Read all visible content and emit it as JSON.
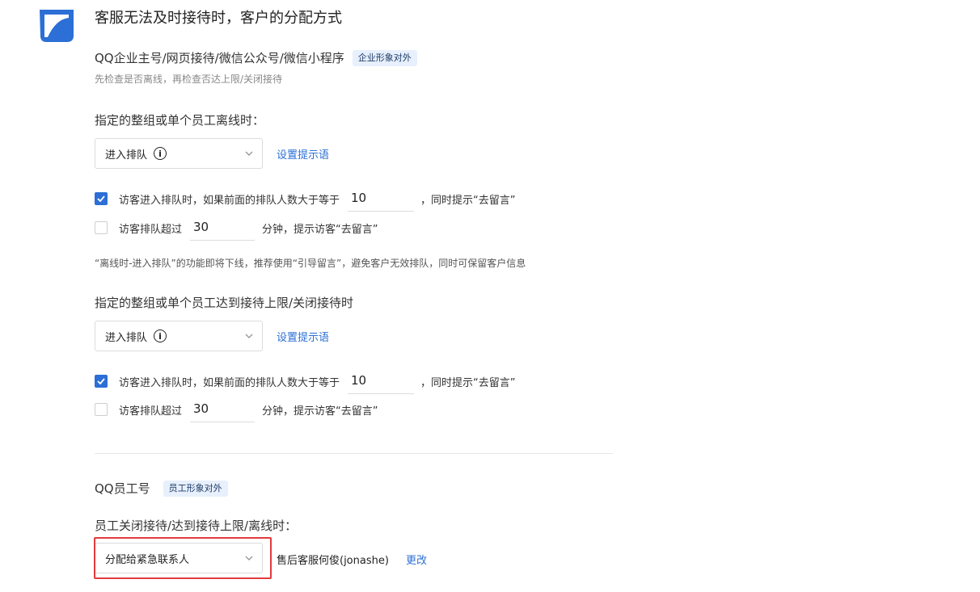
{
  "page": {
    "title": "客服无法及时接待时，客户的分配方式"
  },
  "section_enterprise": {
    "heading": "QQ企业主号/网页接待/微信公众号/微信小程序",
    "tag": "企业形象对外",
    "hint": "先检查是否离线，再检查否达上限/关闭接待",
    "offline": {
      "label": "指定的整组或单个员工离线时：",
      "select_value": "进入排队",
      "link": "设置提示语",
      "opt1": {
        "checked": true,
        "text_before": "访客进入排队时，如果前面的排队人数大于等于",
        "value": "10",
        "text_after": "，同时提示“去留言”"
      },
      "opt2": {
        "checked": false,
        "text_before": "访客排队超过",
        "value": "30",
        "text_after": "分钟，提示访客“去留言”"
      },
      "note": "“离线时-进入排队”的功能即将下线，推荐使用“引导留言”，避免客户无效排队，同时可保留客户信息"
    },
    "limit": {
      "label": "指定的整组或单个员工达到接待上限/关闭接待时",
      "select_value": "进入排队",
      "link": "设置提示语",
      "opt1": {
        "checked": true,
        "text_before": "访客进入排队时，如果前面的排队人数大于等于",
        "value": "10",
        "text_after": "，同时提示“去留言”"
      },
      "opt2": {
        "checked": false,
        "text_before": "访客排队超过",
        "value": "30",
        "text_after": "分钟，提示访客“去留言”"
      }
    }
  },
  "section_staff": {
    "heading": "QQ员工号",
    "tag": "员工形象对外",
    "label": "员工关闭接待/达到接待上限/离线时：",
    "select_value": "分配给紧急联系人",
    "contact": "售后客服何俊(jonashe)",
    "change_link": "更改"
  },
  "colors": {
    "accent": "#2c6fd6",
    "highlight": "#e23b3b",
    "tag_bg": "#e7f0fc"
  }
}
